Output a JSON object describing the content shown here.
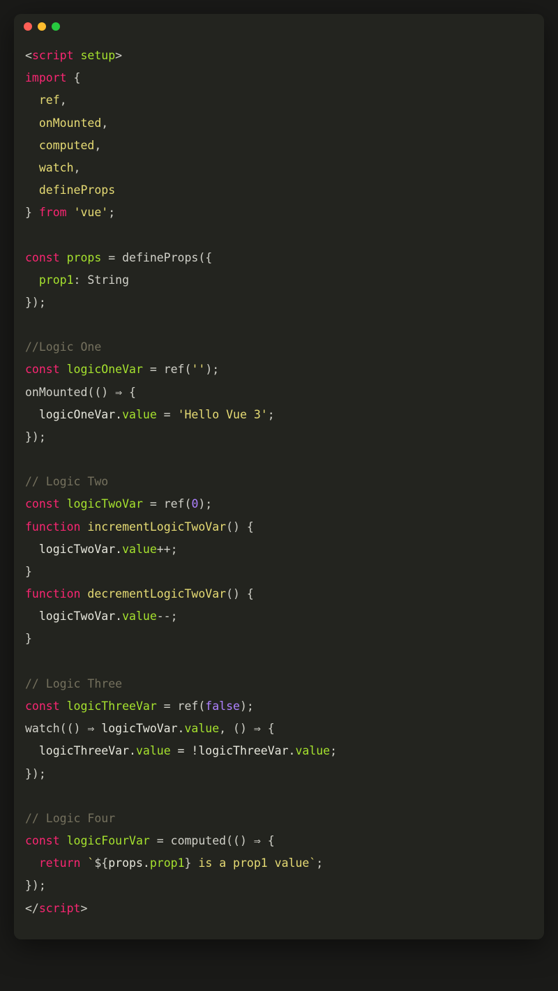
{
  "window": {
    "traffic_lights": [
      "red",
      "yellow",
      "green"
    ]
  },
  "code": {
    "lines": [
      {
        "segments": [
          {
            "t": "<",
            "c": "c-punc"
          },
          {
            "t": "script ",
            "c": "c-tag"
          },
          {
            "t": "setup",
            "c": "c-attr"
          },
          {
            "t": ">",
            "c": "c-punc"
          }
        ]
      },
      {
        "segments": [
          {
            "t": "import",
            "c": "c-keyword"
          },
          {
            "t": " {",
            "c": "c-punc"
          }
        ]
      },
      {
        "segments": [
          {
            "t": "  ",
            "c": ""
          },
          {
            "t": "ref",
            "c": "c-import"
          },
          {
            "t": ",",
            "c": "c-punc"
          }
        ]
      },
      {
        "segments": [
          {
            "t": "  ",
            "c": ""
          },
          {
            "t": "onMounted",
            "c": "c-import"
          },
          {
            "t": ",",
            "c": "c-punc"
          }
        ]
      },
      {
        "segments": [
          {
            "t": "  ",
            "c": ""
          },
          {
            "t": "computed",
            "c": "c-import"
          },
          {
            "t": ",",
            "c": "c-punc"
          }
        ]
      },
      {
        "segments": [
          {
            "t": "  ",
            "c": ""
          },
          {
            "t": "watch",
            "c": "c-import"
          },
          {
            "t": ",",
            "c": "c-punc"
          }
        ]
      },
      {
        "segments": [
          {
            "t": "  ",
            "c": ""
          },
          {
            "t": "defineProps",
            "c": "c-import"
          }
        ]
      },
      {
        "segments": [
          {
            "t": "} ",
            "c": "c-punc"
          },
          {
            "t": "from",
            "c": "c-keyword"
          },
          {
            "t": " ",
            "c": ""
          },
          {
            "t": "'vue'",
            "c": "c-string"
          },
          {
            "t": ";",
            "c": "c-punc"
          }
        ]
      },
      {
        "segments": [
          {
            "t": "",
            "c": ""
          }
        ]
      },
      {
        "segments": [
          {
            "t": "const",
            "c": "c-keyword"
          },
          {
            "t": " ",
            "c": ""
          },
          {
            "t": "props",
            "c": "c-prop"
          },
          {
            "t": " = defineProps({",
            "c": "c-punc"
          }
        ]
      },
      {
        "segments": [
          {
            "t": "  ",
            "c": ""
          },
          {
            "t": "prop1",
            "c": "c-prop"
          },
          {
            "t": ": String",
            "c": "c-type"
          }
        ]
      },
      {
        "segments": [
          {
            "t": "});",
            "c": "c-punc"
          }
        ]
      },
      {
        "segments": [
          {
            "t": "",
            "c": ""
          }
        ]
      },
      {
        "segments": [
          {
            "t": "//Logic One",
            "c": "c-comment"
          }
        ]
      },
      {
        "segments": [
          {
            "t": "const",
            "c": "c-keyword"
          },
          {
            "t": " ",
            "c": ""
          },
          {
            "t": "logicOneVar",
            "c": "c-prop"
          },
          {
            "t": " = ref(",
            "c": "c-punc"
          },
          {
            "t": "''",
            "c": "c-string"
          },
          {
            "t": ");",
            "c": "c-punc"
          }
        ]
      },
      {
        "segments": [
          {
            "t": "onMounted(() ",
            "c": "c-punc"
          },
          {
            "t": "⇒",
            "c": "c-arrow"
          },
          {
            "t": " {",
            "c": "c-punc"
          }
        ]
      },
      {
        "segments": [
          {
            "t": "  logicOneVar.",
            "c": "c-var"
          },
          {
            "t": "value",
            "c": "c-prop"
          },
          {
            "t": " = ",
            "c": "c-punc"
          },
          {
            "t": "'Hello Vue 3'",
            "c": "c-string"
          },
          {
            "t": ";",
            "c": "c-punc"
          }
        ]
      },
      {
        "segments": [
          {
            "t": "});",
            "c": "c-punc"
          }
        ]
      },
      {
        "segments": [
          {
            "t": "",
            "c": ""
          }
        ]
      },
      {
        "segments": [
          {
            "t": "// Logic Two",
            "c": "c-comment"
          }
        ]
      },
      {
        "segments": [
          {
            "t": "const",
            "c": "c-keyword"
          },
          {
            "t": " ",
            "c": ""
          },
          {
            "t": "logicTwoVar",
            "c": "c-prop"
          },
          {
            "t": " = ref(",
            "c": "c-punc"
          },
          {
            "t": "0",
            "c": "c-num"
          },
          {
            "t": ");",
            "c": "c-punc"
          }
        ]
      },
      {
        "segments": [
          {
            "t": "function",
            "c": "c-keyword"
          },
          {
            "t": " ",
            "c": ""
          },
          {
            "t": "incrementLogicTwoVar",
            "c": "c-func"
          },
          {
            "t": "() {",
            "c": "c-punc"
          }
        ]
      },
      {
        "segments": [
          {
            "t": "  logicTwoVar.",
            "c": "c-var"
          },
          {
            "t": "value",
            "c": "c-prop"
          },
          {
            "t": "++;",
            "c": "c-punc"
          }
        ]
      },
      {
        "segments": [
          {
            "t": "}",
            "c": "c-punc"
          }
        ]
      },
      {
        "segments": [
          {
            "t": "function",
            "c": "c-keyword"
          },
          {
            "t": " ",
            "c": ""
          },
          {
            "t": "decrementLogicTwoVar",
            "c": "c-func"
          },
          {
            "t": "() {",
            "c": "c-punc"
          }
        ]
      },
      {
        "segments": [
          {
            "t": "  logicTwoVar.",
            "c": "c-var"
          },
          {
            "t": "value",
            "c": "c-prop"
          },
          {
            "t": "--;",
            "c": "c-punc"
          }
        ]
      },
      {
        "segments": [
          {
            "t": "}",
            "c": "c-punc"
          }
        ]
      },
      {
        "segments": [
          {
            "t": "",
            "c": ""
          }
        ]
      },
      {
        "segments": [
          {
            "t": "// Logic Three",
            "c": "c-comment"
          }
        ]
      },
      {
        "segments": [
          {
            "t": "const",
            "c": "c-keyword"
          },
          {
            "t": " ",
            "c": ""
          },
          {
            "t": "logicThreeVar",
            "c": "c-prop"
          },
          {
            "t": " = ref(",
            "c": "c-punc"
          },
          {
            "t": "false",
            "c": "c-bool"
          },
          {
            "t": ");",
            "c": "c-punc"
          }
        ]
      },
      {
        "segments": [
          {
            "t": "watch(() ",
            "c": "c-punc"
          },
          {
            "t": "⇒",
            "c": "c-arrow"
          },
          {
            "t": " logicTwoVar.",
            "c": "c-var"
          },
          {
            "t": "value",
            "c": "c-prop"
          },
          {
            "t": ", () ",
            "c": "c-punc"
          },
          {
            "t": "⇒",
            "c": "c-arrow"
          },
          {
            "t": " {",
            "c": "c-punc"
          }
        ]
      },
      {
        "segments": [
          {
            "t": "  logicThreeVar.",
            "c": "c-var"
          },
          {
            "t": "value",
            "c": "c-prop"
          },
          {
            "t": " = !logicThreeVar.",
            "c": "c-var"
          },
          {
            "t": "value",
            "c": "c-prop"
          },
          {
            "t": ";",
            "c": "c-punc"
          }
        ]
      },
      {
        "segments": [
          {
            "t": "});",
            "c": "c-punc"
          }
        ]
      },
      {
        "segments": [
          {
            "t": "",
            "c": ""
          }
        ]
      },
      {
        "segments": [
          {
            "t": "// Logic Four",
            "c": "c-comment"
          }
        ]
      },
      {
        "segments": [
          {
            "t": "const",
            "c": "c-keyword"
          },
          {
            "t": " ",
            "c": ""
          },
          {
            "t": "logicFourVar",
            "c": "c-prop"
          },
          {
            "t": " = computed(() ",
            "c": "c-punc"
          },
          {
            "t": "⇒",
            "c": "c-arrow"
          },
          {
            "t": " {",
            "c": "c-punc"
          }
        ]
      },
      {
        "segments": [
          {
            "t": "  ",
            "c": ""
          },
          {
            "t": "return",
            "c": "c-keyword"
          },
          {
            "t": " ",
            "c": ""
          },
          {
            "t": "`",
            "c": "c-templ"
          },
          {
            "t": "${",
            "c": "c-punc"
          },
          {
            "t": "props.",
            "c": "c-var"
          },
          {
            "t": "prop1",
            "c": "c-prop"
          },
          {
            "t": "}",
            "c": "c-punc"
          },
          {
            "t": " is a prop1 value",
            "c": "c-templ"
          },
          {
            "t": "`",
            "c": "c-templ"
          },
          {
            "t": ";",
            "c": "c-punc"
          }
        ]
      },
      {
        "segments": [
          {
            "t": "});",
            "c": "c-punc"
          }
        ]
      },
      {
        "segments": [
          {
            "t": "</",
            "c": "c-punc"
          },
          {
            "t": "script",
            "c": "c-tag"
          },
          {
            "t": ">",
            "c": "c-punc"
          }
        ]
      }
    ]
  }
}
